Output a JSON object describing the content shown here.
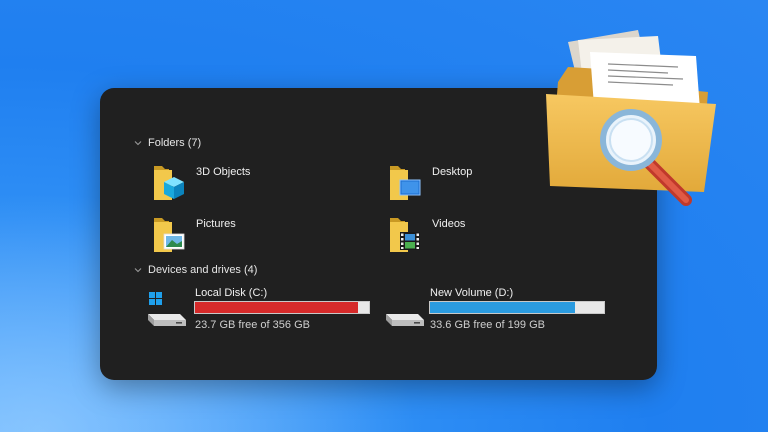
{
  "folders_section": {
    "label": "Folders (7)"
  },
  "folders": [
    {
      "label": "3D Objects",
      "icon": "3d-objects-folder-icon"
    },
    {
      "label": "Desktop",
      "icon": "desktop-folder-icon"
    },
    {
      "label": "Pictures",
      "icon": "pictures-folder-icon"
    },
    {
      "label": "Videos",
      "icon": "videos-folder-icon"
    }
  ],
  "drives_section": {
    "label": "Devices and drives (4)"
  },
  "drives": [
    {
      "name": "Local Disk (C:)",
      "free_text": "23.7 GB free of 356 GB",
      "used_fraction": 0.934,
      "bar_color": "#d62a2a"
    },
    {
      "name": "New Volume (D:)",
      "free_text": "33.6 GB free of 199 GB",
      "used_fraction": 0.831,
      "bar_color": "#2a9be0"
    }
  ],
  "colors": {
    "folder": "#e8b63b",
    "accent_blue": "#2a9be0",
    "warning_red": "#d62a2a",
    "background": "#2a86f2",
    "panel": "#202020"
  }
}
